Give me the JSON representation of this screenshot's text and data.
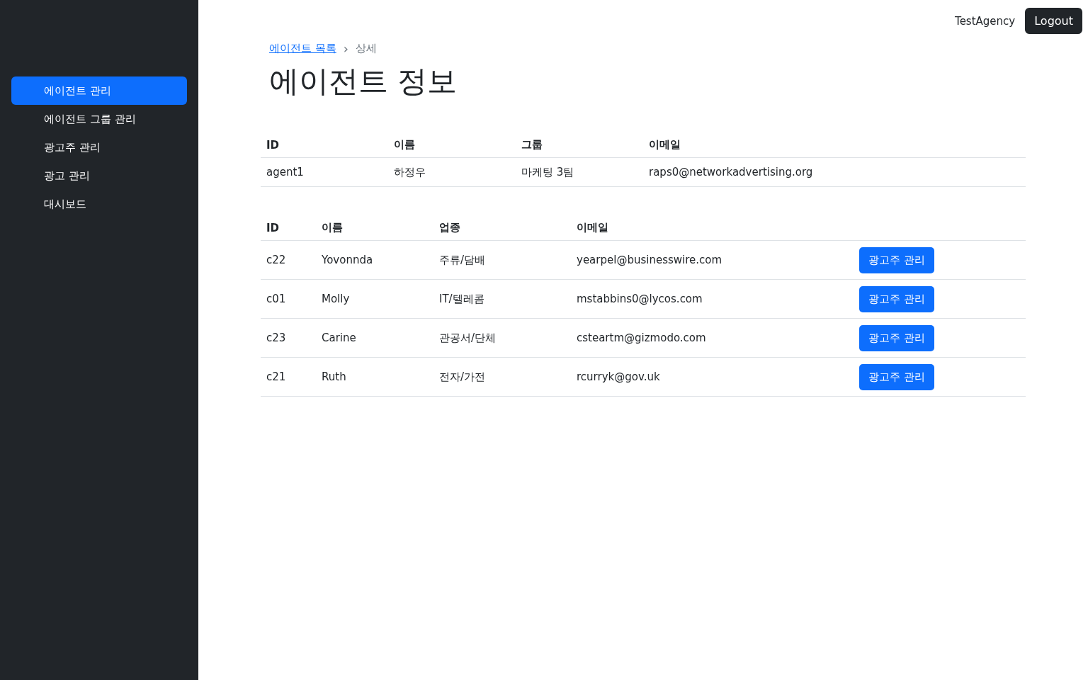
{
  "sidebar": {
    "items": [
      {
        "label": "에이전트 관리",
        "selected": true
      },
      {
        "label": "에이전트 그룹 관리",
        "selected": false
      },
      {
        "label": "광고주 관리",
        "selected": false
      },
      {
        "label": "광고 관리",
        "selected": false
      },
      {
        "label": "대시보드",
        "selected": false
      }
    ]
  },
  "header": {
    "user": "TestAgency",
    "logout": "Logout"
  },
  "breadcrumb": {
    "link": "에이전트 목록",
    "separator": "›",
    "current": "상세"
  },
  "title": "에이전트 정보",
  "agent_table": {
    "columns": [
      "ID",
      "이름",
      "그룹",
      "이메일"
    ],
    "rows": [
      [
        "agent1",
        "하정우",
        "마케팅 3팀",
        "raps0@networkadvertising.org"
      ]
    ]
  },
  "advertiser_table": {
    "columns": [
      "ID",
      "이름",
      "업종",
      "이메일"
    ],
    "rows": [
      {
        "cells": [
          "c22",
          "Yovonnda",
          "주류/담배",
          "yearpel@businesswire.com"
        ],
        "action": "광고주 관리"
      },
      {
        "cells": [
          "c01",
          "Molly",
          "IT/텔레콤",
          "mstabbins0@lycos.com"
        ],
        "action": "광고주 관리"
      },
      {
        "cells": [
          "c23",
          "Carine",
          "관공서/단체",
          "csteartm@gizmodo.com"
        ],
        "action": "광고주 관리"
      },
      {
        "cells": [
          "c21",
          "Ruth",
          "전자/가전",
          "rcurryk@gov.uk"
        ],
        "action": "광고주 관리"
      }
    ]
  }
}
